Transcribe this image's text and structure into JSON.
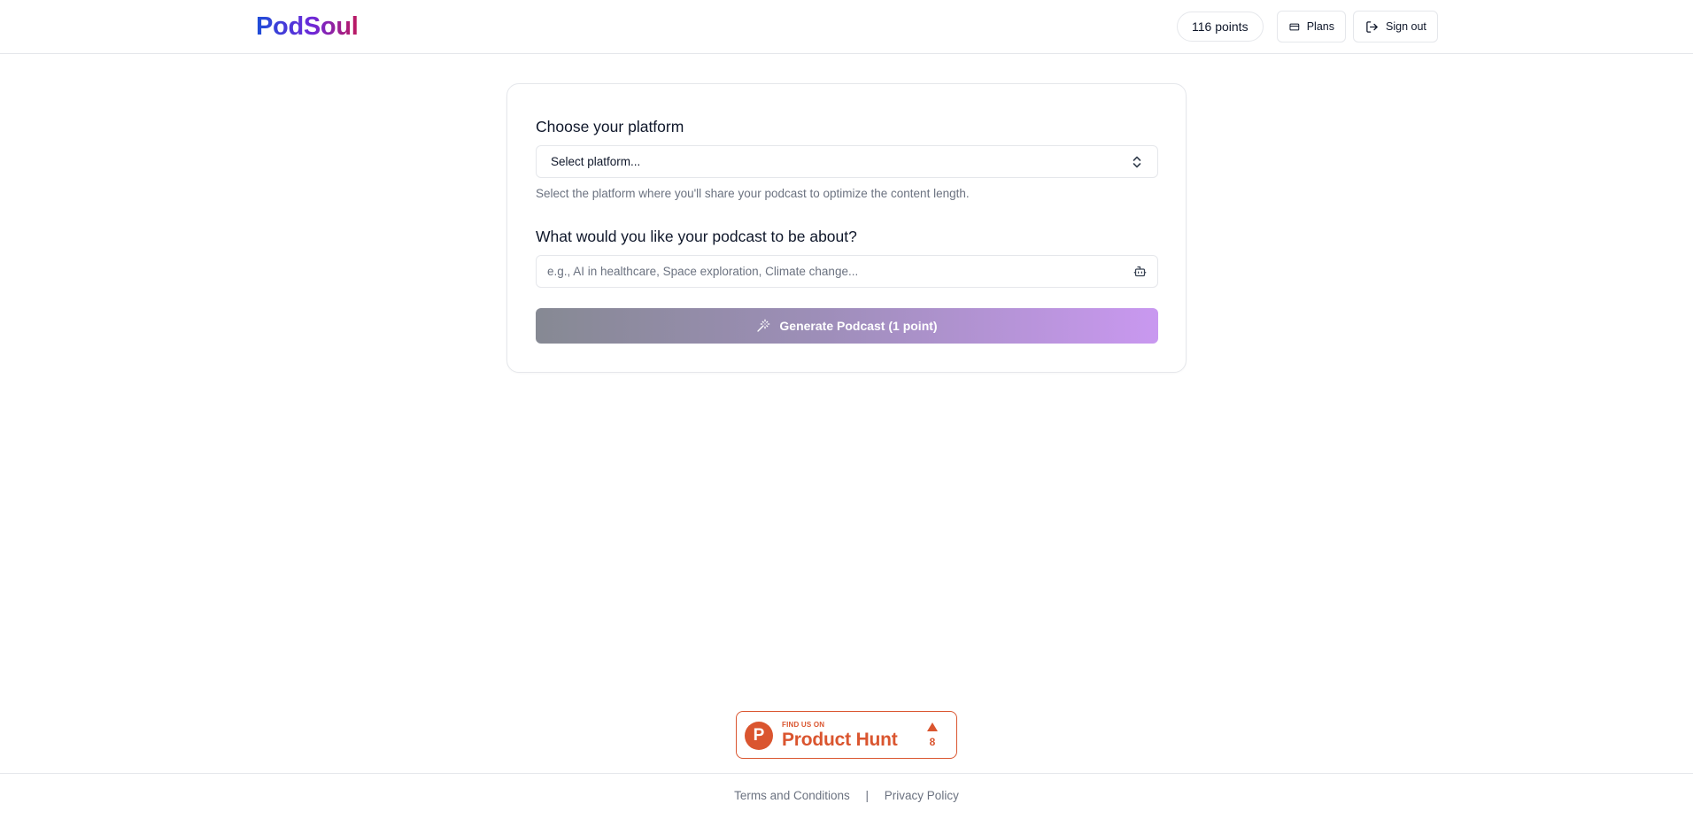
{
  "header": {
    "logo": "PodSoul",
    "points_label": "116 points",
    "plans_label": "Plans",
    "signout_label": "Sign out"
  },
  "form": {
    "platform_heading": "Choose your platform",
    "platform_selected": "Select platform...",
    "platform_help": "Select the platform where you'll share your podcast to optimize the content length.",
    "topic_heading": "What would you like your podcast to be about?",
    "topic_placeholder": "e.g., AI in healthcare, Space exploration, Climate change...",
    "topic_value": "",
    "generate_label": "Generate Podcast (1 point)"
  },
  "badge": {
    "logo_letter": "P",
    "find_text": "FIND US ON",
    "name": "Product Hunt",
    "upvotes": "8"
  },
  "footer": {
    "terms_label": "Terms and Conditions",
    "separator": "|",
    "privacy_label": "Privacy Policy"
  },
  "colors": {
    "product_hunt": "#da552f",
    "border": "#e5e7eb",
    "muted_text": "#6b7280"
  }
}
